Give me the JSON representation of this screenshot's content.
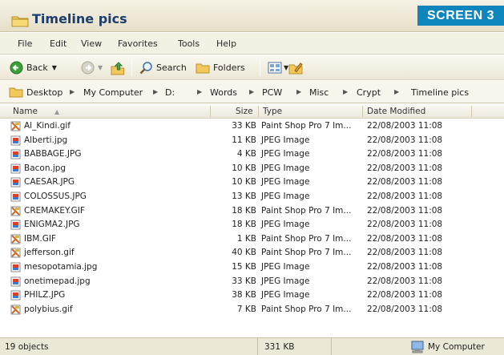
{
  "window": {
    "title": "Timeline pics",
    "badge": "SCREEN 3"
  },
  "menu": [
    "File",
    "Edit",
    "View",
    "Favorites",
    "Tools",
    "Help"
  ],
  "toolbar": {
    "back": "Back",
    "search": "Search",
    "folders": "Folders"
  },
  "address": {
    "crumbs": [
      "Desktop",
      "My Computer",
      "D:",
      "Words",
      "PCW",
      "Misc",
      "Crypt",
      "Timeline pics"
    ]
  },
  "columns": {
    "name": "Name",
    "size": "Size",
    "type": "Type",
    "date": "Date Modified"
  },
  "files": [
    {
      "name": "Al_Kindi.gif",
      "size": "33 KB",
      "type": "Paint Shop Pro 7 Im...",
      "date": "22/08/2003 11:08",
      "icon": "gif-file-icon"
    },
    {
      "name": "Alberti.jpg",
      "size": "11 KB",
      "type": "JPEG Image",
      "date": "22/08/2003 11:08",
      "icon": "jpeg-file-icon"
    },
    {
      "name": "BABBAGE.JPG",
      "size": "4 KB",
      "type": "JPEG Image",
      "date": "22/08/2003 11:08",
      "icon": "jpeg-file-icon"
    },
    {
      "name": "Bacon.jpg",
      "size": "10 KB",
      "type": "JPEG Image",
      "date": "22/08/2003 11:08",
      "icon": "jpeg-file-icon"
    },
    {
      "name": "CAESAR.JPG",
      "size": "10 KB",
      "type": "JPEG Image",
      "date": "22/08/2003 11:08",
      "icon": "jpeg-file-icon"
    },
    {
      "name": "COLOSSUS.JPG",
      "size": "13 KB",
      "type": "JPEG Image",
      "date": "22/08/2003 11:08",
      "icon": "jpeg-file-icon"
    },
    {
      "name": "CREMAKEY.GIF",
      "size": "18 KB",
      "type": "Paint Shop Pro 7 Im...",
      "date": "22/08/2003 11:08",
      "icon": "gif-file-icon"
    },
    {
      "name": "ENIGMA2.JPG",
      "size": "18 KB",
      "type": "JPEG Image",
      "date": "22/08/2003 11:08",
      "icon": "jpeg-file-icon"
    },
    {
      "name": "IBM.GIF",
      "size": "1 KB",
      "type": "Paint Shop Pro 7 Im...",
      "date": "22/08/2003 11:08",
      "icon": "gif-file-icon"
    },
    {
      "name": "jefferson.gif",
      "size": "40 KB",
      "type": "Paint Shop Pro 7 Im...",
      "date": "22/08/2003 11:08",
      "icon": "gif-file-icon"
    },
    {
      "name": "mesopotamia.jpg",
      "size": "15 KB",
      "type": "JPEG Image",
      "date": "22/08/2003 11:08",
      "icon": "jpeg-file-icon"
    },
    {
      "name": "onetimepad.jpg",
      "size": "33 KB",
      "type": "JPEG Image",
      "date": "22/08/2003 11:08",
      "icon": "jpeg-file-icon"
    },
    {
      "name": "PHILZ.JPG",
      "size": "38 KB",
      "type": "JPEG Image",
      "date": "22/08/2003 11:08",
      "icon": "jpeg-file-icon"
    },
    {
      "name": "polybius.gif",
      "size": "7 KB",
      "type": "Paint Shop Pro 7 Im...",
      "date": "22/08/2003 11:08",
      "icon": "gif-file-icon"
    }
  ],
  "status": {
    "objects": "19 objects",
    "total_size": "331 KB",
    "location": "My Computer"
  },
  "colors": {
    "badge": "#0e86bd",
    "title": "#1b3d6f"
  }
}
